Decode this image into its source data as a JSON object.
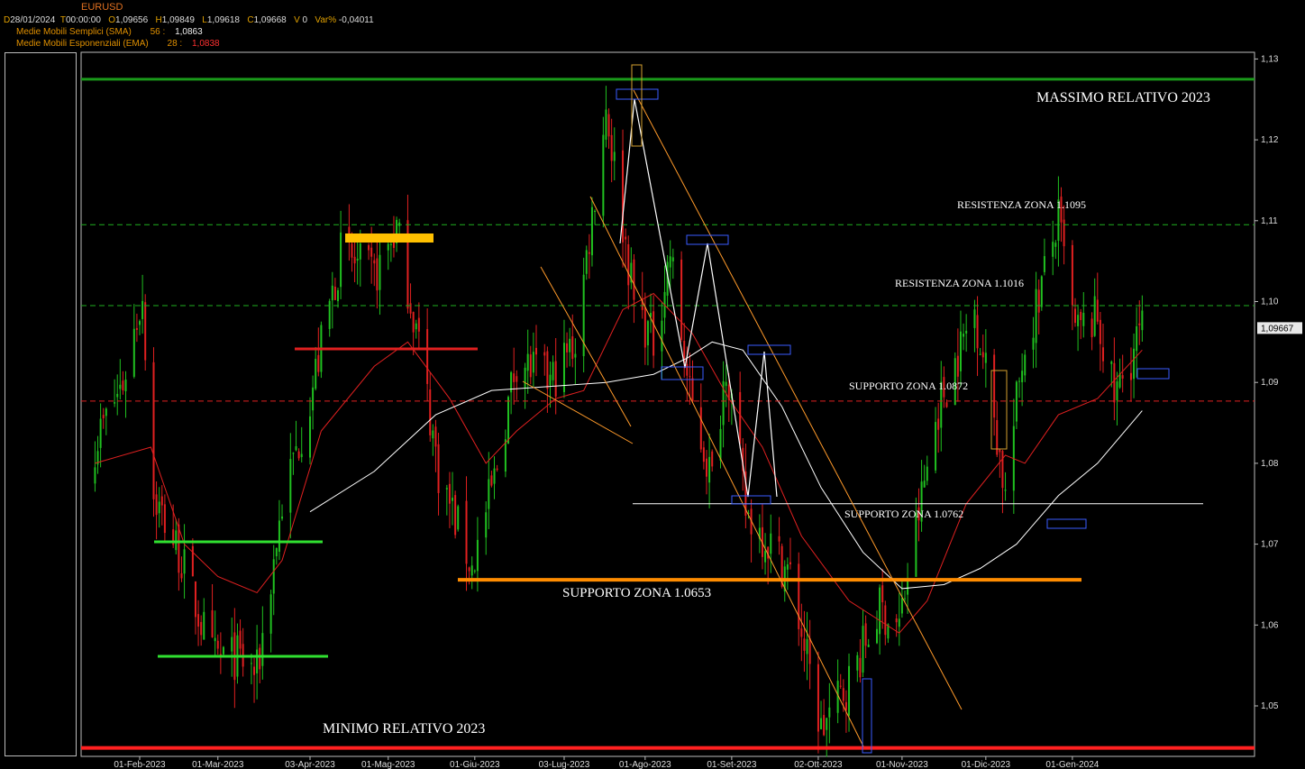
{
  "header": {
    "symbol": "EURUSD",
    "d_label": "D",
    "date": "28/01/2024",
    "t_label": "T",
    "time": "00:00:00",
    "o_label": "O",
    "open": "1,09656",
    "h_label": "H",
    "high": "1,09849",
    "l_label": "L",
    "low": "1,09618",
    "c_label": "C",
    "close": "1,09668",
    "v_label": "V",
    "volume": "0",
    "var_label": "Var%",
    "var": "-0,04011",
    "sma_label": "Medie Mobili Semplici (SMA)",
    "sma_period": "56 :",
    "sma_value": "1,0863",
    "ema_label": "Medie Mobili Esponenziali (EMA)",
    "ema_period": "28 :",
    "ema_value": "1,0838"
  },
  "chart_data": {
    "type": "candlestick",
    "title": "EURUSD",
    "ylim": [
      1.044,
      1.131
    ],
    "y_ticks": [
      "1,13",
      "1,12",
      "1,11",
      "1,10",
      "1,09",
      "1,08",
      "1,07",
      "1,06",
      "1,05"
    ],
    "x_ticks": [
      "01-Feb-2023",
      "01-Mar-2023",
      "03-Apr-2023",
      "01-Mag-2023",
      "01-Giu-2023",
      "03-Lug-2023",
      "01-Ago-2023",
      "01-Set-2023",
      "02-Ott-2023",
      "01-Nov-2023",
      "01-Dic-2023",
      "01-Gen-2024"
    ],
    "last_price": "1,09667",
    "colors": {
      "up": "#20c020",
      "down": "#e02020",
      "sma": "#ffffff",
      "ema": "#e02020"
    },
    "levels": [
      {
        "label": "MASSIMO RELATIVO 2023",
        "value": 1.1275,
        "color": "#1a9a1a"
      },
      {
        "label": "RESISTENZA ZONA 1.1095",
        "value": 1.1095,
        "color": "#20b020"
      },
      {
        "label": "RESISTENZA ZONA 1.1016",
        "value": 1.0995,
        "color": "#20b020"
      },
      {
        "label": "SUPPORTO ZONA 1.0872",
        "value": 1.0877,
        "color": "#e02020"
      },
      {
        "label": "SUPPORTO ZONA 1.0762",
        "value": 1.075,
        "color": "#ffffff"
      },
      {
        "label": "SUPPORTO ZONA 1.0653",
        "value": 1.0656,
        "color": "#ff8c00"
      },
      {
        "label": "MINIMO RELATIVO 2023",
        "value": 1.0448,
        "color": "#ff2020"
      }
    ],
    "close_path": [
      [
        "2023-01-16",
        1.0825
      ],
      [
        "2023-01-26",
        1.09
      ],
      [
        "2023-02-02",
        1.101
      ],
      [
        "2023-02-06",
        1.076
      ],
      [
        "2023-02-15",
        1.069
      ],
      [
        "2023-02-27",
        1.056
      ],
      [
        "2023-03-08",
        1.056
      ],
      [
        "2023-03-15",
        1.054
      ],
      [
        "2023-03-24",
        1.075
      ],
      [
        "2023-04-03",
        1.088
      ],
      [
        "2023-04-14",
        1.106
      ],
      [
        "2023-04-26",
        1.103
      ],
      [
        "2023-05-04",
        1.109
      ],
      [
        "2023-05-12",
        1.095
      ],
      [
        "2023-05-19",
        1.079
      ],
      [
        "2023-05-31",
        1.067
      ],
      [
        "2023-06-08",
        1.078
      ],
      [
        "2023-06-16",
        1.093
      ],
      [
        "2023-06-28",
        1.09
      ],
      [
        "2023-07-07",
        1.095
      ],
      [
        "2023-07-18",
        1.124
      ],
      [
        "2023-07-28",
        1.1
      ],
      [
        "2023-08-04",
        1.095
      ],
      [
        "2023-08-10",
        1.106
      ],
      [
        "2023-08-17",
        1.088
      ],
      [
        "2023-08-25",
        1.078
      ],
      [
        "2023-08-30",
        1.093
      ],
      [
        "2023-09-06",
        1.074
      ],
      [
        "2023-09-15",
        1.07
      ],
      [
        "2023-09-22",
        1.066
      ],
      [
        "2023-10-03",
        1.047
      ],
      [
        "2023-10-13",
        1.053
      ],
      [
        "2023-10-24",
        1.062
      ],
      [
        "2023-10-31",
        1.06
      ],
      [
        "2023-11-06",
        1.072
      ],
      [
        "2023-11-14",
        1.087
      ],
      [
        "2023-11-27",
        1.099
      ],
      [
        "2023-12-04",
        1.086
      ],
      [
        "2023-12-08",
        1.076
      ],
      [
        "2023-12-14",
        1.093
      ],
      [
        "2023-12-27",
        1.11
      ],
      [
        "2024-01-02",
        1.096
      ],
      [
        "2024-01-10",
        1.098
      ],
      [
        "2024-01-16",
        1.088
      ],
      [
        "2024-01-26",
        1.0967
      ]
    ],
    "sma_path": [
      [
        "2023-04-03",
        1.074
      ],
      [
        "2023-04-26",
        1.079
      ],
      [
        "2023-05-18",
        1.086
      ],
      [
        "2023-06-07",
        1.089
      ],
      [
        "2023-06-28",
        1.0895
      ],
      [
        "2023-07-18",
        1.09
      ],
      [
        "2023-08-04",
        1.091
      ],
      [
        "2023-08-16",
        1.093
      ],
      [
        "2023-08-25",
        1.095
      ],
      [
        "2023-09-05",
        1.094
      ],
      [
        "2023-09-19",
        1.087
      ],
      [
        "2023-10-03",
        1.077
      ],
      [
        "2023-10-18",
        1.069
      ],
      [
        "2023-11-01",
        1.0645
      ],
      [
        "2023-11-16",
        1.065
      ],
      [
        "2023-11-29",
        1.067
      ],
      [
        "2023-12-12",
        1.07
      ],
      [
        "2023-12-27",
        1.076
      ],
      [
        "2024-01-10",
        1.08
      ],
      [
        "2024-01-26",
        1.0865
      ]
    ],
    "ema_path": [
      [
        "2023-01-16",
        1.08
      ],
      [
        "2023-02-05",
        1.082
      ],
      [
        "2023-02-17",
        1.07
      ],
      [
        "2023-03-01",
        1.066
      ],
      [
        "2023-03-15",
        1.064
      ],
      [
        "2023-03-24",
        1.068
      ],
      [
        "2023-04-07",
        1.084
      ],
      [
        "2023-04-26",
        1.092
      ],
      [
        "2023-05-08",
        1.095
      ],
      [
        "2023-05-23",
        1.088
      ],
      [
        "2023-06-05",
        1.08
      ],
      [
        "2023-06-16",
        1.084
      ],
      [
        "2023-06-30",
        1.088
      ],
      [
        "2023-07-10",
        1.089
      ],
      [
        "2023-07-24",
        1.099
      ],
      [
        "2023-08-04",
        1.101
      ],
      [
        "2023-08-18",
        1.096
      ],
      [
        "2023-08-31",
        1.088
      ],
      [
        "2023-09-12",
        1.082
      ],
      [
        "2023-09-26",
        1.071
      ],
      [
        "2023-10-13",
        1.063
      ],
      [
        "2023-10-31",
        1.059
      ],
      [
        "2023-11-10",
        1.063
      ],
      [
        "2023-11-24",
        1.075
      ],
      [
        "2023-12-08",
        1.081
      ],
      [
        "2023-12-15",
        1.08
      ],
      [
        "2023-12-27",
        1.086
      ],
      [
        "2024-01-10",
        1.088
      ],
      [
        "2024-01-26",
        1.094
      ]
    ]
  }
}
